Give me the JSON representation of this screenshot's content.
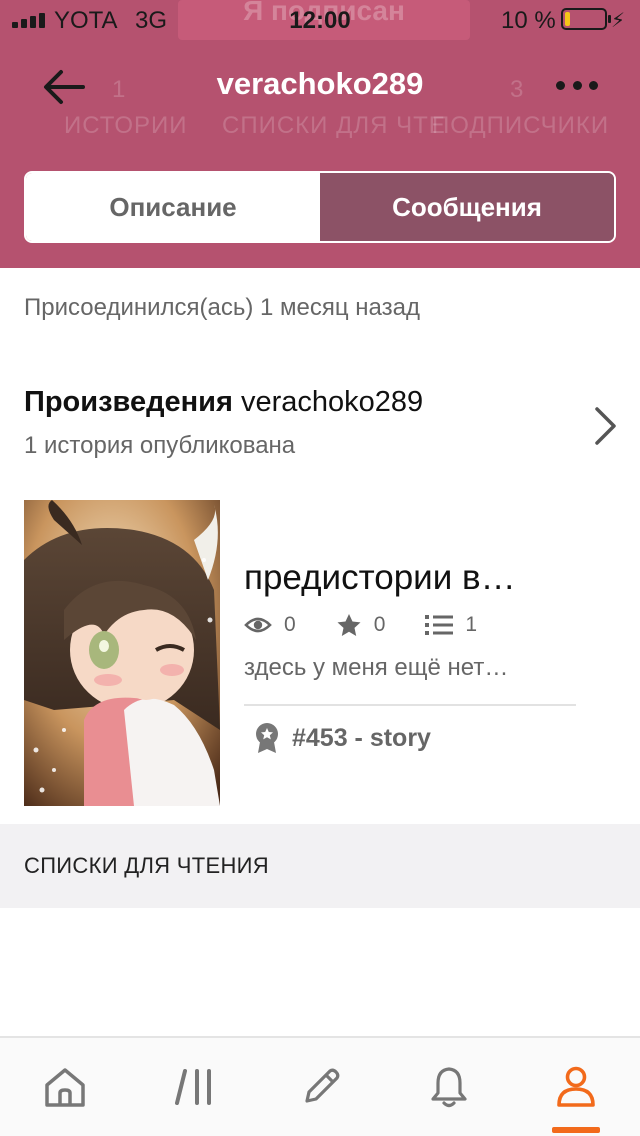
{
  "status_bar": {
    "carrier": "YOTA",
    "network": "3G",
    "time": "12:00",
    "battery_percent": "10 %",
    "battery_level": 0.12
  },
  "header": {
    "username": "verachoko289",
    "background_stats": {
      "stories_count": "1",
      "stories_label": "ИСТОРИИ",
      "reading_lists_label": "СПИСКИ ДЛЯ ЧТЕ",
      "followers_count": "3",
      "followers_label": "ПОДПИСЧИКИ",
      "follow_label": "Я подписан"
    },
    "tabs": [
      {
        "label": "Описание",
        "selected": false
      },
      {
        "label": "Сообщения",
        "selected": true
      }
    ]
  },
  "joined_text": "Присоединился(ась) 1 месяц назад",
  "works": {
    "title_prefix": "Произведения",
    "title_user": "verachoko289",
    "subtitle": "1 история опубликована"
  },
  "story": {
    "title": "предистории в…",
    "reads": "0",
    "votes": "0",
    "parts": "1",
    "description": "здесь у меня ещё нет…",
    "rank": "#453 - story"
  },
  "reading_lists_label": "СПИСКИ ДЛЯ ЧТЕНИЯ",
  "tabbar": {
    "items": [
      "home-icon",
      "browse-icon",
      "write-icon",
      "notifications-icon",
      "profile-icon"
    ],
    "active": "profile-icon"
  },
  "colors": {
    "header": "#b5526f",
    "selected_tab": "#8c5266",
    "accent": "#f26a1b",
    "battery": "#f5c518"
  }
}
